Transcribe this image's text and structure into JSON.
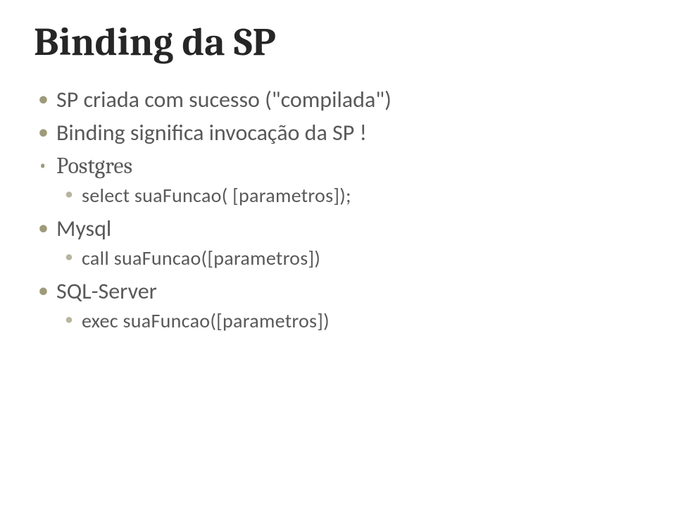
{
  "slide": {
    "title": "Binding da SP",
    "bullets": [
      {
        "text": "SP criada com sucesso (\"compilada\")",
        "serif": false
      },
      {
        "text": "Binding significa invocação da SP !",
        "serif": false
      },
      {
        "text": "Postgres",
        "serif": true,
        "children": [
          {
            "text": "select suaFuncao( [parametros]);"
          }
        ]
      },
      {
        "text": "Mysql",
        "serif": false,
        "children": [
          {
            "text": "call suaFuncao([parametros])"
          }
        ]
      },
      {
        "text": "SQL-Server",
        "serif": false,
        "children": [
          {
            "text": "exec suaFuncao([parametros])"
          }
        ]
      }
    ]
  }
}
